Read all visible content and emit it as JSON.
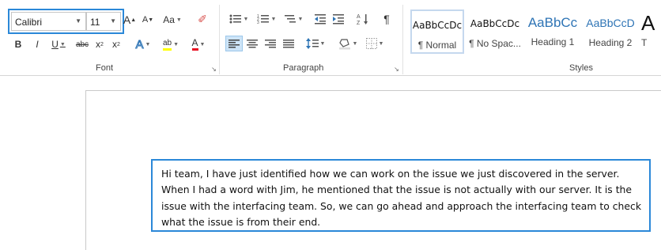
{
  "font": {
    "family": "Calibri",
    "size": "11",
    "group_label": "Font",
    "buttons": {
      "grow": "A",
      "shrink": "A",
      "change_case": "Aa",
      "bold": "B",
      "italic": "I",
      "underline": "U",
      "strikethrough": "abc",
      "subscript": "x",
      "superscript": "x",
      "text_effects": "A",
      "highlight": "ab",
      "font_color": "A"
    }
  },
  "paragraph": {
    "group_label": "Paragraph",
    "show_marks": "¶"
  },
  "styles": {
    "group_label": "Styles",
    "items": [
      {
        "preview": "AaBbCcDc",
        "label": "¶ Normal"
      },
      {
        "preview": "AaBbCcDc",
        "label": "¶ No Spac..."
      },
      {
        "preview": "AaBbCc",
        "label": "Heading 1"
      },
      {
        "preview": "AaBbCcD",
        "label": "Heading 2"
      },
      {
        "preview": "A",
        "label": "T"
      }
    ]
  },
  "colors": {
    "accent": "#2b88d8",
    "highlight": "#ffff00",
    "font_color": "#e81123",
    "heading": "#2e74b5"
  },
  "document": {
    "text": "Hi team, I have just identified how we can work on the issue we just discovered in the server. When I had a word with Jim, he mentioned that the issue is not actually with our server. It is the issue with the interfacing team. So, we can go ahead and approach the interfacing team to check what the issue is from their end."
  }
}
